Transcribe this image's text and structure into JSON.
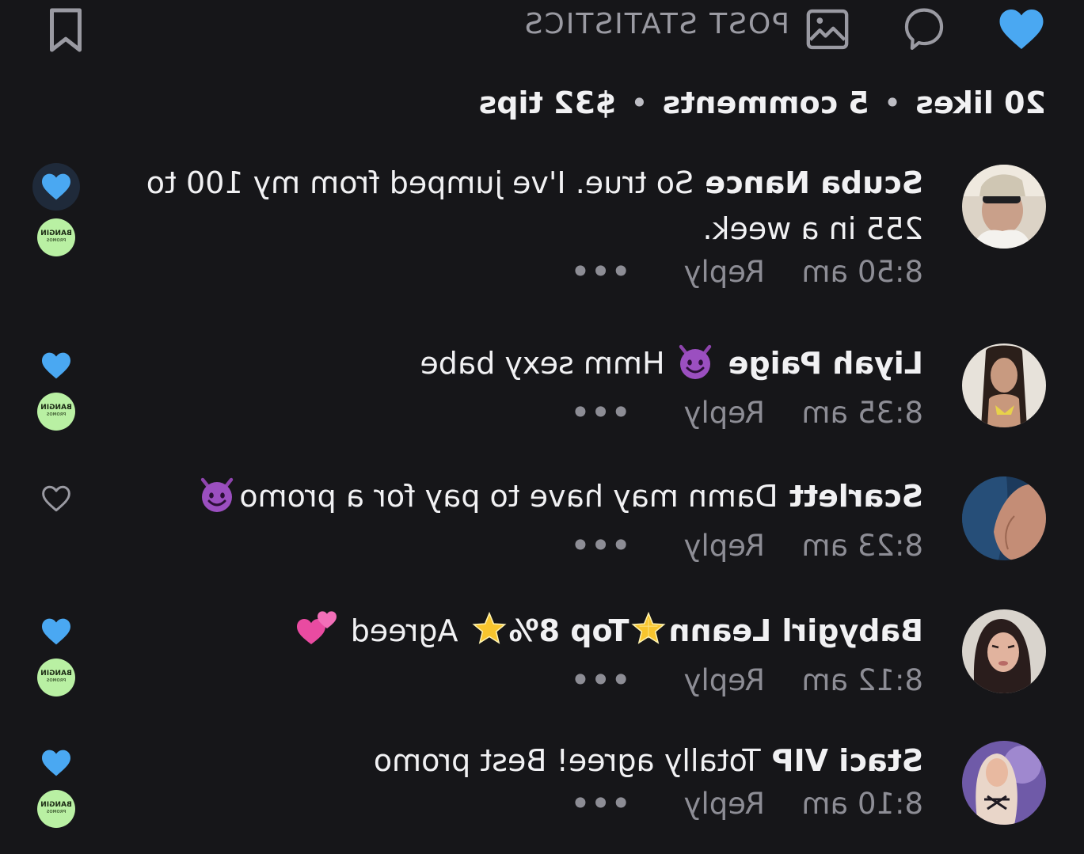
{
  "actions": {
    "like_icon": "heart-filled-icon",
    "comment_icon": "comment-bubble-icon",
    "stats_icon": "image-chart-icon",
    "stats_label": "POST STATISTICS",
    "bookmark_icon": "bookmark-icon"
  },
  "summary": {
    "likes": "20 likes",
    "separator": "•",
    "comments": "5 comments",
    "tips": "$32 tips"
  },
  "colors": {
    "background": "#161619",
    "accent_blue": "#4aa8f2",
    "muted_text": "#8d8d95",
    "badge_green": "#b9f0a3"
  },
  "comments": [
    {
      "username": "Scuba Nance",
      "text": "So true. I've jumped from my 100 to 255 in a week.",
      "time": "8:50 am",
      "reply": "Reply",
      "more": "•••",
      "liked": true,
      "creator_badge": "BANGIN",
      "creator_badge_sub": "PROMOS"
    },
    {
      "username": "Liyah Paige",
      "text_after_emoji": "Hmm sexy babe",
      "emoji_before": "smiling-devil-emoji",
      "time": "8:35 am",
      "reply": "Reply",
      "more": "•••",
      "liked": true,
      "creator_badge": "BANGIN",
      "creator_badge_sub": "PROMOS"
    },
    {
      "username": "Scarlett",
      "text": "Damn may have to pay for a promo",
      "emoji_after": "smiling-devil-emoji",
      "time": "8:23 am",
      "reply": "Reply",
      "more": "•••",
      "liked": false
    },
    {
      "username": "Babygirl Leann",
      "top": "Top 8%",
      "text_after": "Agreed",
      "emoji_star": "glowing-star-emoji",
      "emoji_heart": "two-hearts-emoji",
      "time": "8:12 am",
      "reply": "Reply",
      "more": "•••",
      "liked": true,
      "creator_badge": "BANGIN",
      "creator_badge_sub": "PROMOS"
    },
    {
      "username": "Staci VIP",
      "text": "Totally agree! Best promo",
      "time": "8:10 am",
      "reply": "Reply",
      "more": "•••",
      "liked": true,
      "creator_badge": "BANGIN",
      "creator_badge_sub": "PROMOS"
    }
  ]
}
